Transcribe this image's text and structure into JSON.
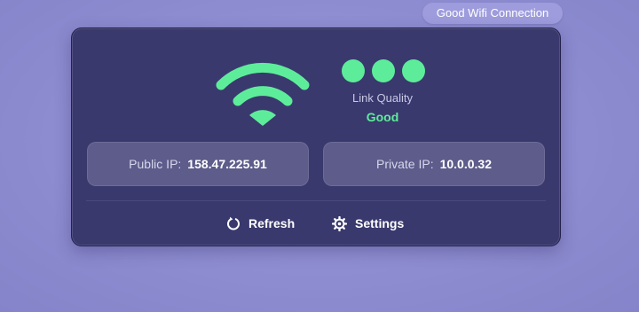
{
  "tooltip": {
    "text": "Good Wifi Connection"
  },
  "status": {
    "icon": "wifi-icon",
    "quality_dots": 3,
    "link_quality_label": "Link Quality",
    "link_quality_value": "Good"
  },
  "ip": {
    "public_label": "Public IP:",
    "public_value": "158.47.225.91",
    "private_label": "Private IP:",
    "private_value": "10.0.0.32"
  },
  "actions": {
    "refresh_label": "Refresh",
    "refresh_icon": "refresh-icon",
    "settings_label": "Settings",
    "settings_icon": "gear-icon"
  },
  "colors": {
    "accent": "#5ded9a",
    "panel": "#3a396e",
    "card": "#5d5c8b",
    "background": "#918fd3"
  }
}
